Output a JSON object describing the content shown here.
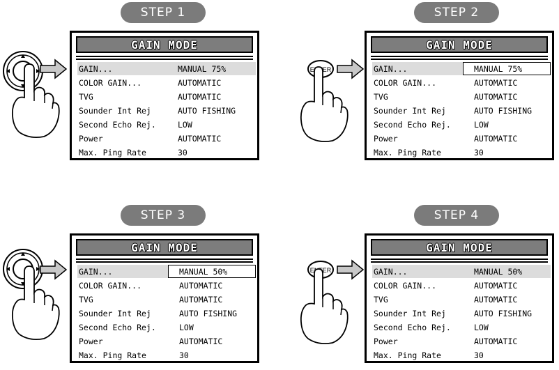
{
  "screen": {
    "title": "GAIN MODE",
    "labels": [
      "GAIN...",
      "COLOR GAIN...",
      "TVG",
      "Sounder Int Rej",
      "Second Echo Rej.",
      "Power",
      "Max. Ping Rate"
    ],
    "values": [
      "AUTOMATIC",
      "AUTOMATIC",
      "AUTO FISHING",
      "LOW",
      "AUTOMATIC",
      "30"
    ]
  },
  "enter_label": "ENTER",
  "steps": [
    {
      "label": "STEP  1",
      "gain_value": "MANUAL 75%",
      "control": "dial-knob"
    },
    {
      "label": "STEP  2",
      "gain_value": "MANUAL  75%",
      "control": "enter-button"
    },
    {
      "label": "STEP  3",
      "gain_value": "MANUAL 50%",
      "control": "dial-knob"
    },
    {
      "label": "STEP  4",
      "gain_value": "MANUAL 50%",
      "control": "enter-button"
    }
  ]
}
